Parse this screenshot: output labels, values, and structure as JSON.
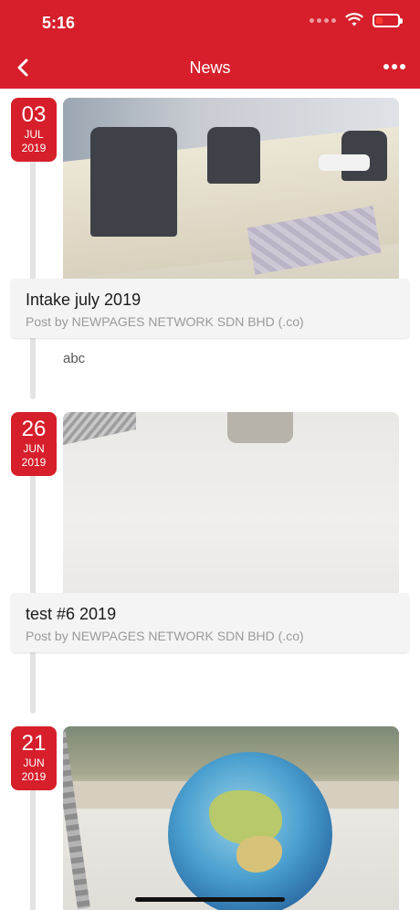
{
  "status_bar": {
    "time": "5:16"
  },
  "header": {
    "title": "News"
  },
  "posts": [
    {
      "day": "03",
      "month": "JUL",
      "year": "2019",
      "title": "Intake july 2019",
      "meta": "Post by NEWPAGES NETWORK SDN BHD (.co)",
      "body": "abc"
    },
    {
      "day": "26",
      "month": "JUN",
      "year": "2019",
      "title": "test #6 2019",
      "meta": "Post by NEWPAGES NETWORK SDN BHD (.co)",
      "body": ""
    },
    {
      "day": "21",
      "month": "JUN",
      "year": "2019"
    }
  ],
  "colors": {
    "accent": "#d61f2b",
    "card_bg": "#f4f4f4",
    "timeline": "#e3e3e3"
  },
  "icons": {
    "back": "chevron-left-icon",
    "more": "more-horizontal-icon",
    "wifi": "wifi-icon",
    "battery": "battery-icon"
  }
}
